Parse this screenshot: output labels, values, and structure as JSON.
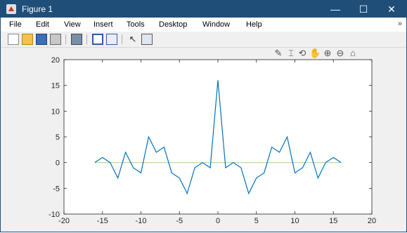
{
  "window": {
    "title": "Figure 1",
    "minimize": "—",
    "maximize": "☐",
    "close": "✕"
  },
  "menubar": {
    "items": [
      "File",
      "Edit",
      "View",
      "Insert",
      "Tools",
      "Desktop",
      "Window",
      "Help"
    ],
    "overflow": "»"
  },
  "toolbar": {
    "icons": [
      "new-figure-icon",
      "open-file-icon",
      "save-icon",
      "print-icon",
      "link-plot-icon",
      "colorbar-icon",
      "legend-icon",
      "edit-plot-arrow-icon",
      "property-inspector-icon"
    ]
  },
  "axes_toolbar": {
    "icons": [
      "brush-icon",
      "data-tips-icon",
      "rotate-icon",
      "pan-icon",
      "zoom-in-icon",
      "zoom-out-icon",
      "home-icon"
    ]
  },
  "chart_data": {
    "type": "line",
    "title": "",
    "xlabel": "",
    "ylabel": "",
    "xlim": [
      -20,
      20
    ],
    "ylim": [
      -10,
      20
    ],
    "xticks": [
      -20,
      -15,
      -10,
      -5,
      0,
      5,
      10,
      15,
      20
    ],
    "yticks": [
      -10,
      -5,
      0,
      5,
      10,
      15,
      20
    ],
    "grid": false,
    "series": [
      {
        "color": "#0072bd",
        "x": [
          -16,
          -15,
          -14,
          -13,
          -12,
          -11,
          -10,
          -9,
          -8,
          -7,
          -6,
          -5,
          -4,
          -3,
          -2,
          -1,
          0,
          1,
          2,
          3,
          4,
          5,
          6,
          7,
          8,
          9,
          10,
          11,
          12,
          13,
          14,
          15,
          16
        ],
        "y": [
          0,
          1,
          0,
          -3,
          2,
          -1,
          -2,
          5,
          2,
          3,
          -2,
          -3,
          -6,
          -1,
          0,
          -1,
          16,
          -1,
          0,
          -1,
          -6,
          -3,
          -2,
          3,
          2,
          5,
          -2,
          -1,
          2,
          -3,
          0,
          1,
          0
        ]
      },
      {
        "color": "#b5d98f",
        "x": [
          -16,
          16
        ],
        "y": [
          0,
          0
        ]
      }
    ]
  }
}
